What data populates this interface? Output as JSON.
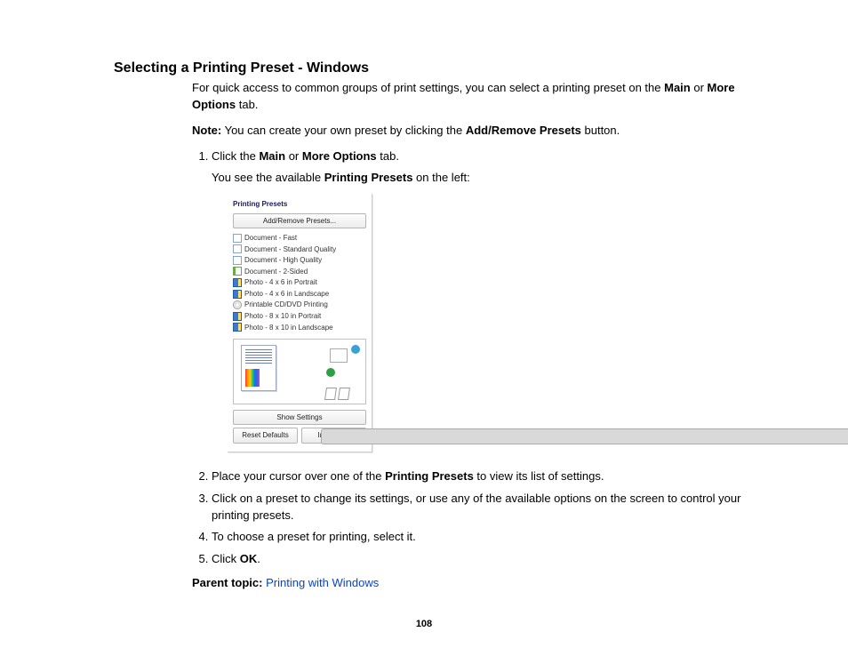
{
  "heading": "Selecting a Printing Preset - Windows",
  "intro": {
    "pre": "For quick access to common groups of print settings, you can select a printing preset on the ",
    "b1": "Main",
    "mid": " or ",
    "b2": "More Options",
    "post": " tab."
  },
  "note": {
    "label": "Note:",
    "pre": " You can create your own preset by clicking the ",
    "b": "Add/Remove Presets",
    "post": " button."
  },
  "steps": {
    "s1": {
      "pre": "Click the ",
      "b1": "Main",
      "mid": " or ",
      "b2": "More Options",
      "post": " tab.",
      "sub_pre": "You see the available ",
      "sub_b": "Printing Presets",
      "sub_post": " on the left:"
    },
    "s2": {
      "pre": "Place your cursor over one of the ",
      "b": "Printing Presets",
      "post": " to view its list of settings."
    },
    "s3": "Click on a preset to change its settings, or use any of the available options on the screen to control your printing presets.",
    "s4": "To choose a preset for printing, select it.",
    "s5": {
      "pre": "Click ",
      "b": "OK",
      "post": "."
    }
  },
  "parent": {
    "label": "Parent topic:",
    "link": "Printing with Windows"
  },
  "page_number": "108",
  "panel": {
    "title": "Printing Presets",
    "add_remove": "Add/Remove Presets...",
    "items": [
      {
        "label": "Document - Fast",
        "icon": "doc"
      },
      {
        "label": "Document - Standard Quality",
        "icon": "doc"
      },
      {
        "label": "Document - High Quality",
        "icon": "doc"
      },
      {
        "label": "Document - 2-Sided",
        "icon": "doc2"
      },
      {
        "label": "Photo - 4 x 6 in Portrait",
        "icon": "photo"
      },
      {
        "label": "Photo - 4 x 6 in Landscape",
        "icon": "photo"
      },
      {
        "label": "Printable CD/DVD Printing",
        "icon": "cd"
      },
      {
        "label": "Photo - 8 x 10 in Portrait",
        "icon": "photo"
      },
      {
        "label": "Photo - 8 x 10 in Landscape",
        "icon": "photo"
      }
    ],
    "show_settings": "Show Settings",
    "reset_defaults": "Reset Defaults",
    "ink_levels": "Ink Levels"
  }
}
